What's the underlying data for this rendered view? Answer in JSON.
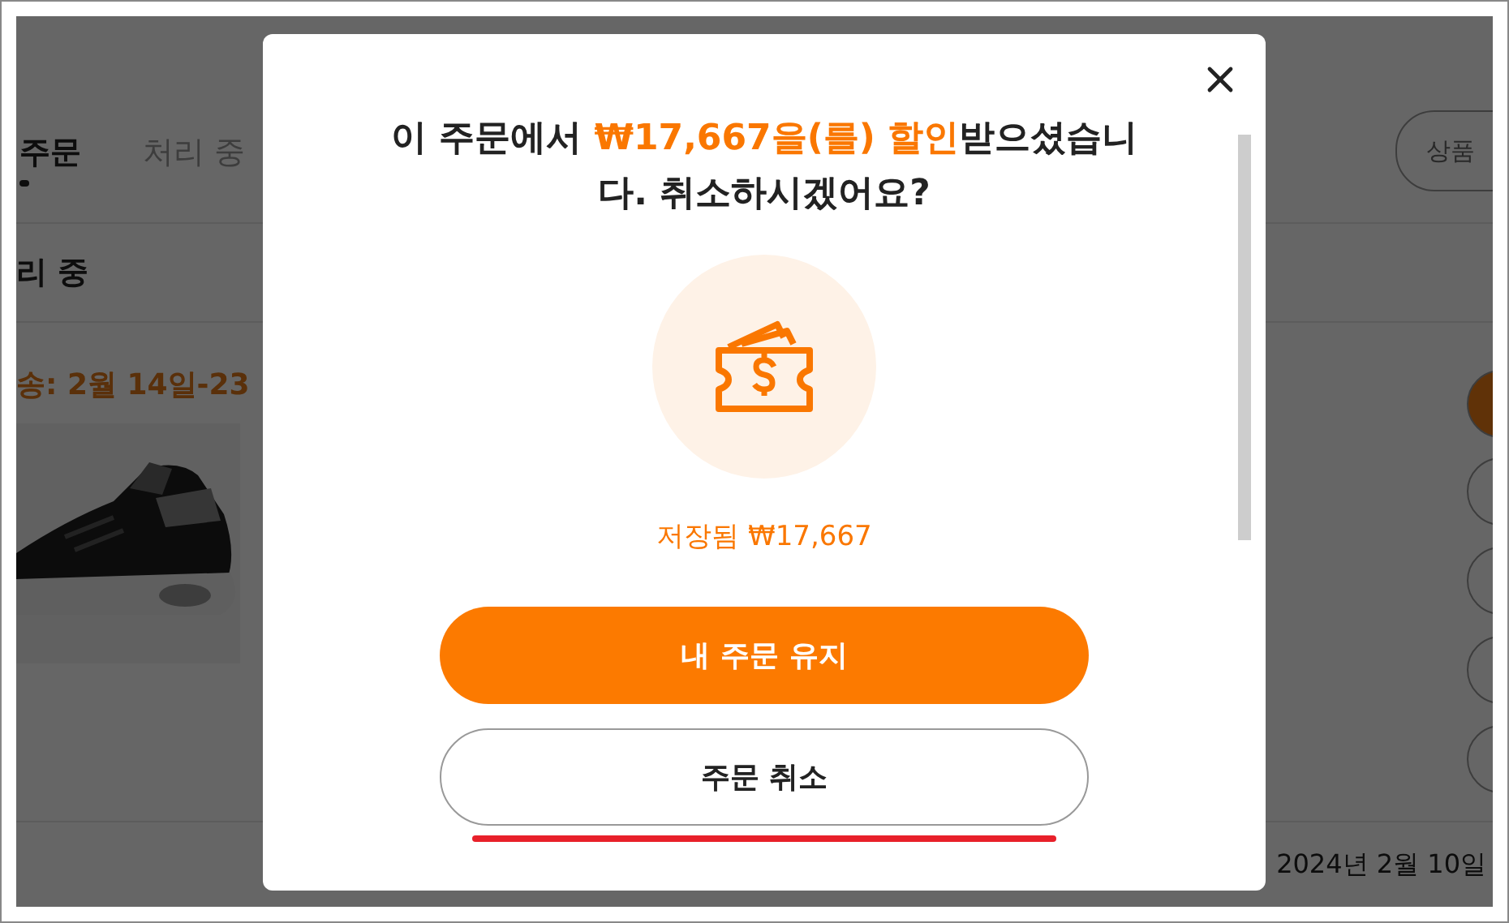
{
  "background_page": {
    "tabs": [
      {
        "label": "주문",
        "selected": true
      },
      {
        "label": "처리 중",
        "selected": false
      }
    ],
    "search_button": "상품",
    "section_title": "리 중",
    "shipping": "송: 2월 14일-23",
    "date": "2024년 2월 10일"
  },
  "dialog": {
    "title_parts": [
      {
        "text": "이 주문에서 ",
        "highlight": false
      },
      {
        "text": "₩17,667을(를) 할인",
        "highlight": true
      },
      {
        "text": "받으셨습니다. 취소하시겠어요?",
        "highlight": false
      }
    ],
    "saved_label": "저장됨 ₩17,667",
    "buttons": [
      {
        "label": "내 주문 유지",
        "kind": "primary"
      },
      {
        "label": "주문 취소",
        "kind": "secondary"
      }
    ]
  }
}
